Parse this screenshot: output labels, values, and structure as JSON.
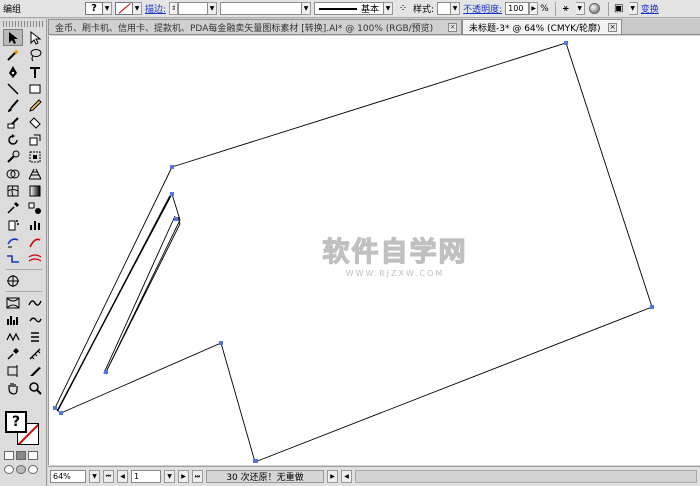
{
  "control_bar": {
    "group_label": "编组",
    "fill_symbol": "?",
    "stroke_link_label": "描边:",
    "stroke_style_label": "基本",
    "style_label": "样式:",
    "opacity_link_label": "不透明度:",
    "opacity_value": "100",
    "opacity_unit": "%",
    "transform_link_label": "变换"
  },
  "tabs": [
    {
      "label": "金币、刷卡机、信用卡、提款机、PDA每金融卖矢量图标素材 [转换].AI* @ 100% (RGB/预览)",
      "active": false
    },
    {
      "label": "未标题-3* @ 64% (CMYK/轮廓)",
      "active": true
    }
  ],
  "tab_close_glyph": "×",
  "toolbox": {
    "fill_symbol": "?"
  },
  "canvas": {
    "watermark_title": "软件自学网",
    "watermark_url": "WWW.RJZXW.COM"
  },
  "status_bar": {
    "zoom": "64%",
    "page": "1",
    "status_text": "30 次还原！无重做"
  },
  "colors": {
    "anchor": "#5577dd",
    "path": "#000000",
    "link": "#1a34c8",
    "watermark": "#c0c0c0"
  }
}
